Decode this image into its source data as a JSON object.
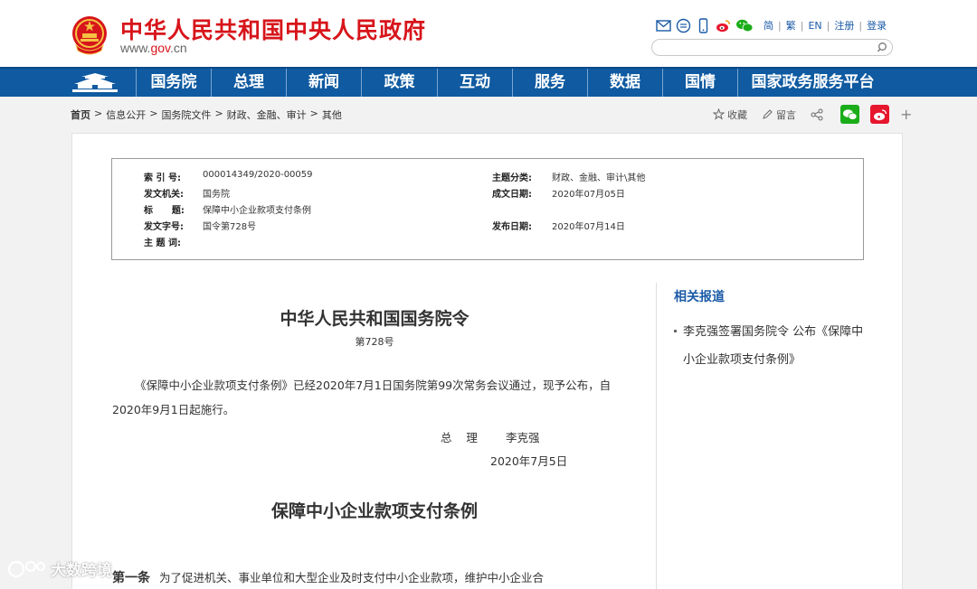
{
  "header": {
    "site_title": "中华人民共和国中央人民政府",
    "url_prefix": "www.",
    "url_gov": "gov",
    "url_suffix": ".cn",
    "links": [
      "简",
      "繁",
      "EN",
      "注册",
      "登录"
    ],
    "search_placeholder": ""
  },
  "nav": {
    "items": [
      "国务院",
      "总理",
      "新闻",
      "政策",
      "互动",
      "服务",
      "数据",
      "国情",
      "国家政务服务平台"
    ]
  },
  "breadcrumb": [
    "首页",
    "信息公开",
    "国务院文件",
    "财政、金融、审计",
    "其他"
  ],
  "share": {
    "favorite": "收藏",
    "comment": "留言"
  },
  "meta": {
    "index_label": "索 引 号:",
    "index_value": "000014349/2020-00059",
    "category_label": "主题分类:",
    "category_value": "财政、金融、审计\\其他",
    "issuer_label": "发文机关:",
    "issuer_value": "国务院",
    "created_label": "成文日期:",
    "created_value": "2020年07月05日",
    "title_label": "标      题:",
    "title_value": "保障中小企业款项支付条例",
    "docno_label": "发文字号:",
    "docno_value": "国令第728号",
    "published_label": "发布日期:",
    "published_value": "2020年07月14日",
    "keywords_label": "主 题 词:"
  },
  "article": {
    "title": "中华人民共和国国务院令",
    "number": "第728号",
    "paragraph": "《保障中小企业款项支付条例》已经2020年7月1日国务院第99次常务会议通过，现予公布，自2020年9月1日起施行。",
    "sign_role": "总    理",
    "sign_name": "李克强",
    "sign_date": "2020年7月5日",
    "law_title": "保障中小企业款项支付条例",
    "article1_label": "第一条",
    "article1_text": "为了促进机关、事业单位和大型企业及时支付中小企业款项，维护中小企业合"
  },
  "related": {
    "title": "相关报道",
    "items": [
      "李克强签署国务院令 公布《保障中小企业款项支付条例》"
    ]
  },
  "watermark": "大数跨境",
  "colors": {
    "brand_red": "#d7151b",
    "nav_blue": "#0f5aa0",
    "link_blue": "#1a5aa6",
    "wechat_green": "#1aad19",
    "weibo_red": "#e6162d"
  }
}
